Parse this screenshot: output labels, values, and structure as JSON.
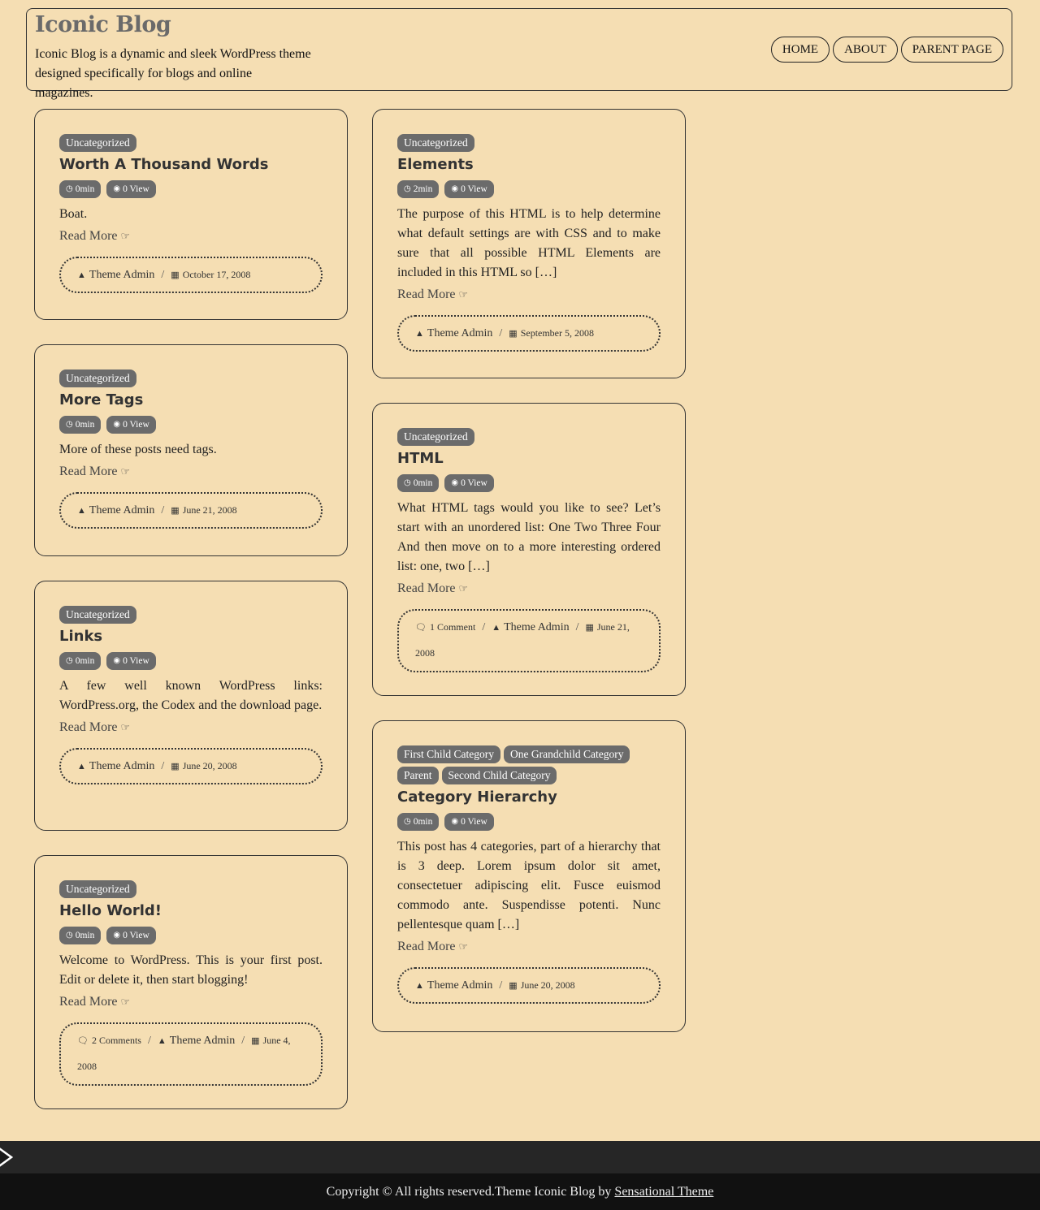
{
  "site": {
    "title": "Iconic Blog",
    "description": "Iconic Blog is a dynamic and sleek WordPress theme designed specifically for blogs and online magazines."
  },
  "nav": [
    "HOME",
    "ABOUT",
    "PARENT PAGE"
  ],
  "read_more": "Read More",
  "posts": [
    {
      "categories": [
        "Uncategorized"
      ],
      "title": "Worth A Thousand Words",
      "read_time": "0min",
      "views": "0 View",
      "excerpt": "Boat.",
      "comments": "",
      "author": "Theme Admin",
      "date": "October 17, 2008"
    },
    {
      "categories": [
        "Uncategorized"
      ],
      "title": "Elements",
      "read_time": "2min",
      "views": "0 View",
      "excerpt": "The purpose of this HTML is to help determine what default settings are with CSS and to make sure that all possible HTML Elements are included in this HTML so […]",
      "comments": "",
      "author": "Theme Admin",
      "date": "September 5, 2008"
    },
    {
      "categories": [
        "Uncategorized"
      ],
      "title": "More Tags",
      "read_time": "0min",
      "views": "0 View",
      "excerpt": "More of these posts need tags.",
      "comments": "",
      "author": "Theme Admin",
      "date": "June 21, 2008"
    },
    {
      "categories": [
        "Uncategorized"
      ],
      "title": "HTML",
      "read_time": "0min",
      "views": "0 View",
      "excerpt": "What HTML tags would you like to see? Let’s start with an unordered list: One Two Three Four And then move on to a more interesting ordered list: one, two […]",
      "comments": "1 Comment",
      "author": "Theme Admin",
      "date": "June 21, 2008"
    },
    {
      "categories": [
        "Uncategorized"
      ],
      "title": "Links",
      "read_time": "0min",
      "views": "0 View",
      "excerpt": "A few well known WordPress links: WordPress.org, the Codex and the download page.",
      "comments": "",
      "author": "Theme Admin",
      "date": "June 20, 2008"
    },
    {
      "categories": [
        "First Child Category",
        "One Grandchild Category",
        "Parent",
        "Second Child Category"
      ],
      "title": "Category Hierarchy",
      "read_time": "0min",
      "views": "0 View",
      "excerpt": "This post has 4 categories, part of a hierarchy that is 3 deep. Lorem ipsum dolor sit amet, consectetuer adipiscing elit. Fusce euismod commodo ante. Suspendisse potenti. Nunc pellentesque quam […]",
      "comments": "",
      "author": "Theme Admin",
      "date": "June 20, 2008"
    },
    {
      "categories": [
        "Uncategorized"
      ],
      "title": "Hello World!",
      "read_time": "0min",
      "views": "0 View",
      "excerpt": "Welcome to WordPress. This is your first post. Edit or delete it, then start blogging!",
      "comments": "2 Comments",
      "author": "Theme Admin",
      "date": "June 4, 2008"
    }
  ],
  "footer": {
    "copyright": "Copyright © All rights reserved.Theme Iconic Blog by ",
    "link": "Sensational Theme"
  },
  "icons": {
    "clock": "clock-icon",
    "eye": "eye-icon",
    "user": "user-icon",
    "calendar": "calendar-icon",
    "comments": "comments-icon",
    "hand": "hand-pointer-icon"
  }
}
